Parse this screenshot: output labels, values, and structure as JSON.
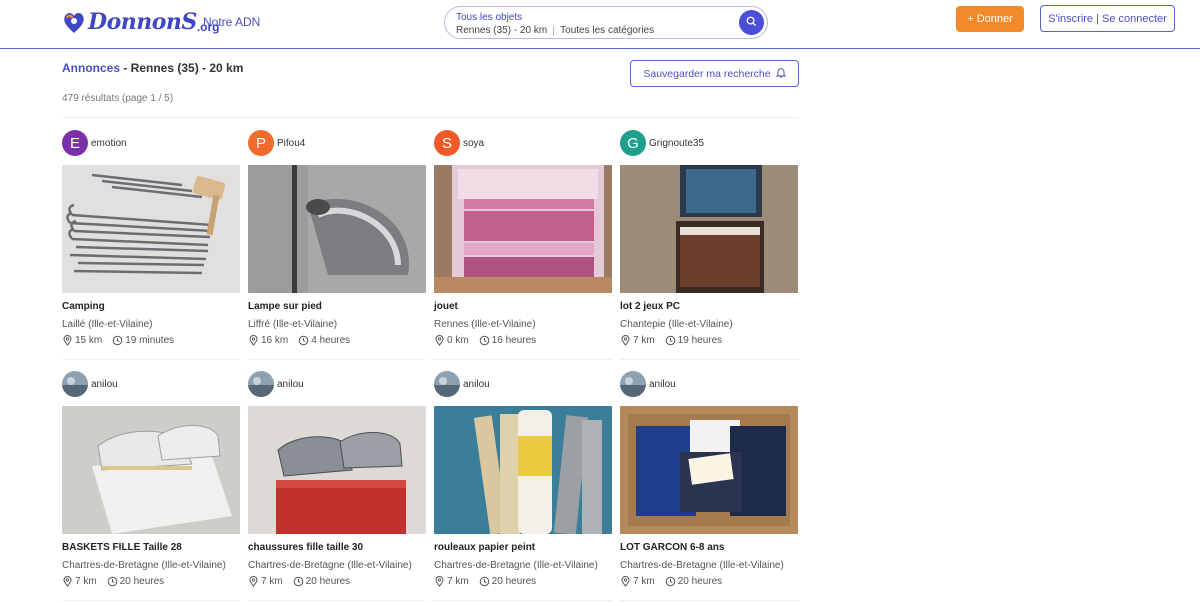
{
  "header": {
    "logo_text": "DonnonS",
    "logo_tld": ".org",
    "nav_adn": "Notre ADN",
    "search_line1": "Tous les objets",
    "search_location": "Rennes (35) - 20 km",
    "search_category": "Toutes les catégories",
    "donate_label": "+ Donner",
    "login_label": "S'inscrire | Se connecter",
    "brand_color": "#3f47c4",
    "accent_orange": "#f08a2a"
  },
  "page": {
    "crumb_link": "Annonces",
    "crumb_rest": " - Rennes (35) - 20 km",
    "results": "479 résultats (page 1 / 5)",
    "save_search_label": "Sauvegarder ma recherche"
  },
  "listings": [
    {
      "user": "emotion",
      "avatar_letter": "E",
      "avatar_color": "#7b2fa8",
      "title": "Camping",
      "location": "Laillé (Ille-et-Vilaine)",
      "distance": "15 km",
      "age": "19 minutes"
    },
    {
      "user": "Pifou4",
      "avatar_letter": "P",
      "avatar_color": "#f26a2e",
      "title": "Lampe sur pied",
      "location": "Liffré (Ille-et-Vilaine)",
      "distance": "16 km",
      "age": "4 heures"
    },
    {
      "user": "soya",
      "avatar_letter": "S",
      "avatar_color": "#f05a28",
      "title": "jouet",
      "location": "Rennes (Ille-et-Vilaine)",
      "distance": "0 km",
      "age": "16 heures"
    },
    {
      "user": "Grignoute35",
      "avatar_letter": "G",
      "avatar_color": "#1f9e8a",
      "title": "lot 2 jeux PC",
      "location": "Chantepie (Ille-et-Vilaine)",
      "distance": "7 km",
      "age": "19 heures"
    },
    {
      "user": "anilou",
      "avatar_letter": "",
      "avatar_color": "#6f8190",
      "title": "BASKETS FILLE Taille 28",
      "location": "Chartres-de-Bretagne (Ille-et-Vilaine)",
      "distance": "7 km",
      "age": "20 heures"
    },
    {
      "user": "anilou",
      "avatar_letter": "",
      "avatar_color": "#6f8190",
      "title": "chaussures fille taille 30",
      "location": "Chartres-de-Bretagne (Ille-et-Vilaine)",
      "distance": "7 km",
      "age": "20 heures"
    },
    {
      "user": "anilou",
      "avatar_letter": "",
      "avatar_color": "#6f8190",
      "title": "rouleaux papier peint",
      "location": "Chartres-de-Bretagne (Ille-et-Vilaine)",
      "distance": "7 km",
      "age": "20 heures"
    },
    {
      "user": "anilou",
      "avatar_letter": "",
      "avatar_color": "#6f8190",
      "title": "LOT GARCON 6-8 ans",
      "location": "Chartres-de-Bretagne (Ille-et-Vilaine)",
      "distance": "7 km",
      "age": "20 heures"
    }
  ]
}
